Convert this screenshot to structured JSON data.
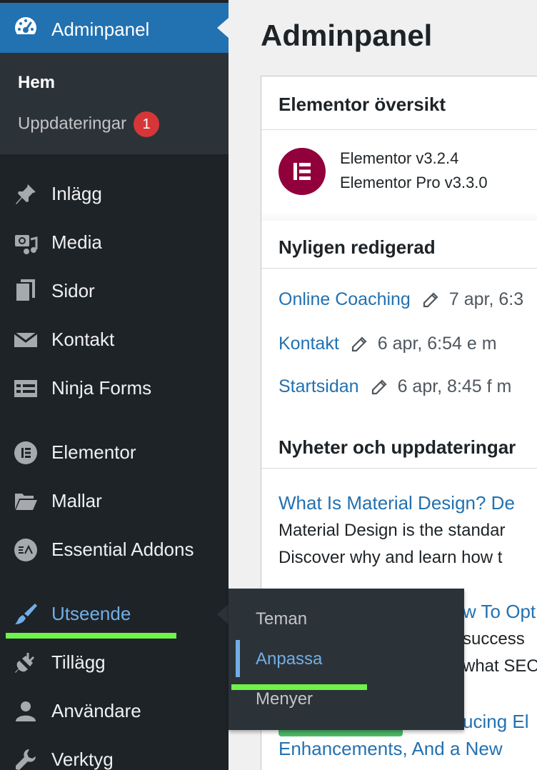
{
  "sidebar": {
    "current": {
      "label": "Adminpanel",
      "icon": "dashboard-icon"
    },
    "submenu": {
      "home": "Hem",
      "updates": "Uppdateringar",
      "updates_badge": "1"
    },
    "items": [
      {
        "label": "Inlägg",
        "icon": "pushpin-icon"
      },
      {
        "label": "Media",
        "icon": "media-icon"
      },
      {
        "label": "Sidor",
        "icon": "pages-icon"
      },
      {
        "label": "Kontakt",
        "icon": "envelope-icon"
      },
      {
        "label": "Ninja Forms",
        "icon": "forms-icon"
      },
      {
        "label": "Elementor",
        "icon": "elementor-icon"
      },
      {
        "label": "Mallar",
        "icon": "folder-icon"
      },
      {
        "label": "Essential Addons",
        "icon": "ea-icon"
      },
      {
        "label": "Utseende",
        "icon": "paintbrush-icon"
      },
      {
        "label": "Tillägg",
        "icon": "plugin-icon"
      },
      {
        "label": "Användare",
        "icon": "user-icon"
      },
      {
        "label": "Verktyg",
        "icon": "wrench-icon"
      }
    ]
  },
  "flyout": {
    "items": [
      "Teman",
      "Anpassa",
      "Menyer"
    ],
    "active_index": 1
  },
  "main": {
    "title": "Adminpanel",
    "overview": {
      "heading": "Elementor översikt",
      "version_free": "Elementor v3.2.4",
      "version_pro": "Elementor Pro v3.3.0"
    },
    "recent": {
      "heading": "Nyligen redigerad",
      "rows": [
        {
          "title": "Online Coaching",
          "date": "7 apr, 6:3"
        },
        {
          "title": "Kontakt",
          "date": "6 apr, 6:54 e m"
        },
        {
          "title": "Startsidan",
          "date": "6 apr, 8:45 f m"
        }
      ]
    },
    "news": {
      "heading": "Nyheter och uppdateringar",
      "items": [
        {
          "title": "What Is Material Design? De",
          "line1": "Material Design is the standar",
          "line2": "Discover why and learn how t"
        },
        {
          "title": "w To Opt",
          "line1": "success",
          "line2": "what SEO"
        },
        {
          "title": "ucing El",
          "line1": "Enhancements, And a New"
        }
      ]
    }
  },
  "colors": {
    "sidebar_bg": "#1d2327",
    "accent": "#2271b1",
    "highlight": "#72aee6",
    "badge": "#d63638",
    "annotation": "#6ff24a"
  }
}
